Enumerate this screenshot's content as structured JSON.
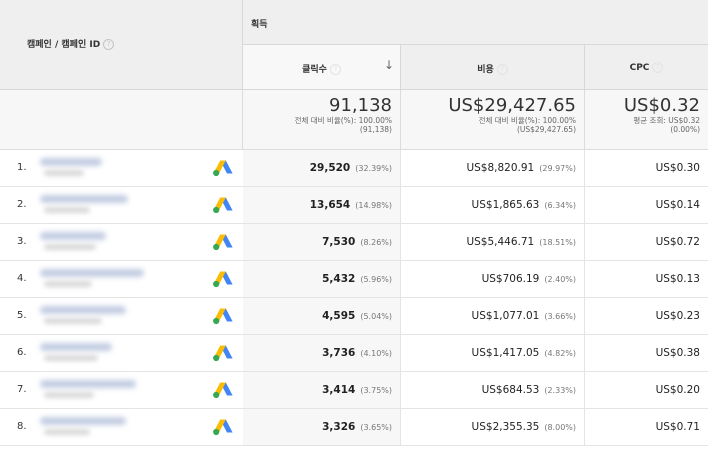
{
  "header": {
    "campaign_col_label": "캠페인 / 캠페인 ID",
    "group_label": "획득",
    "columns": {
      "clicks": "클릭수",
      "cost": "비용",
      "cpc": "CPC"
    },
    "help_glyph": "?",
    "sort_glyph": "↓"
  },
  "totals": {
    "clicks": {
      "value": "91,138",
      "line1": "전체 대비 비율(%): 100.00%",
      "line2": "(91,138)"
    },
    "cost": {
      "value": "US$29,427.65",
      "line1": "전체 대비 비율(%): 100.00%",
      "line2": "(US$29,427.65)"
    },
    "cpc": {
      "value": "US$0.32",
      "line1": "평균 조회: US$0.32",
      "line2": "(0.00%)"
    }
  },
  "rows": [
    {
      "num": "1.",
      "clicks": "29,520",
      "clicks_pct": "(32.39%)",
      "cost": "US$8,820.91",
      "cost_pct": "(29.97%)",
      "cpc": "US$0.30"
    },
    {
      "num": "2.",
      "clicks": "13,654",
      "clicks_pct": "(14.98%)",
      "cost": "US$1,865.63",
      "cost_pct": "(6.34%)",
      "cpc": "US$0.14"
    },
    {
      "num": "3.",
      "clicks": "7,530",
      "clicks_pct": "(8.26%)",
      "cost": "US$5,446.71",
      "cost_pct": "(18.51%)",
      "cpc": "US$0.72"
    },
    {
      "num": "4.",
      "clicks": "5,432",
      "clicks_pct": "(5.96%)",
      "cost": "US$706.19",
      "cost_pct": "(2.40%)",
      "cpc": "US$0.13"
    },
    {
      "num": "5.",
      "clicks": "4,595",
      "clicks_pct": "(5.04%)",
      "cost": "US$1,077.01",
      "cost_pct": "(3.66%)",
      "cpc": "US$0.23"
    },
    {
      "num": "6.",
      "clicks": "3,736",
      "clicks_pct": "(4.10%)",
      "cost": "US$1,417.05",
      "cost_pct": "(4.82%)",
      "cpc": "US$0.38"
    },
    {
      "num": "7.",
      "clicks": "3,414",
      "clicks_pct": "(3.75%)",
      "cost": "US$684.53",
      "cost_pct": "(2.33%)",
      "cpc": "US$0.20"
    },
    {
      "num": "8.",
      "clicks": "3,326",
      "clicks_pct": "(3.65%)",
      "cost": "US$2,355.35",
      "cost_pct": "(8.00%)",
      "cpc": "US$0.71"
    }
  ],
  "icons": {
    "row_icon": "google-ads-icon",
    "help": "help-circle-icon",
    "sort": "sort-descending-icon"
  },
  "colors": {
    "ads_blue": "#4285F4",
    "ads_yellow": "#FBBC04",
    "ads_green": "#34A853"
  }
}
